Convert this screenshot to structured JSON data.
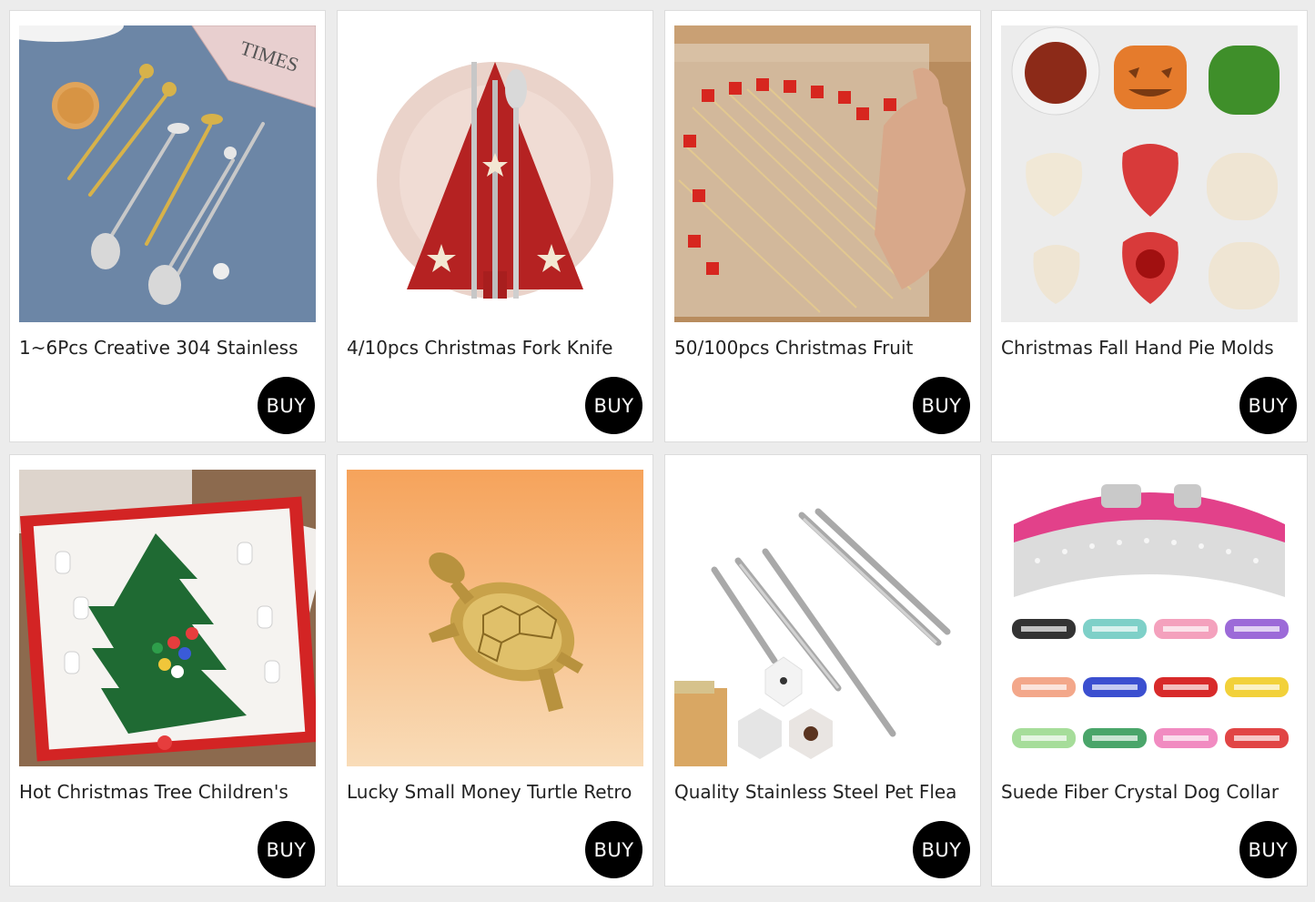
{
  "products": [
    {
      "title": "1~6Pcs Creative 304 Stainless",
      "buy_label": "BUY",
      "image_icon": "cat-cutlery-set-image"
    },
    {
      "title": "4/10pcs Christmas Fork Knife",
      "buy_label": "BUY",
      "image_icon": "christmas-tree-cutlery-holder-image"
    },
    {
      "title": "50/100pcs Christmas Fruit",
      "buy_label": "BUY",
      "image_icon": "christmas-fruit-picks-image"
    },
    {
      "title": "Christmas Fall Hand Pie Molds",
      "buy_label": "BUY",
      "image_icon": "pie-molds-image"
    },
    {
      "title": "Hot Christmas Tree Children's",
      "buy_label": "BUY",
      "image_icon": "wooden-christmas-tree-toy-image"
    },
    {
      "title": "Lucky Small Money Turtle Retro",
      "buy_label": "BUY",
      "image_icon": "brass-turtle-image"
    },
    {
      "title": "Quality Stainless Steel Pet Flea",
      "buy_label": "BUY",
      "image_icon": "flea-tweezers-image"
    },
    {
      "title": "Suede Fiber Crystal Dog Collar",
      "buy_label": "BUY",
      "image_icon": "crystal-dog-collar-image"
    }
  ],
  "colors": {
    "buy_button": "#000000",
    "card_bg": "#ffffff",
    "page_bg": "#ececec"
  }
}
